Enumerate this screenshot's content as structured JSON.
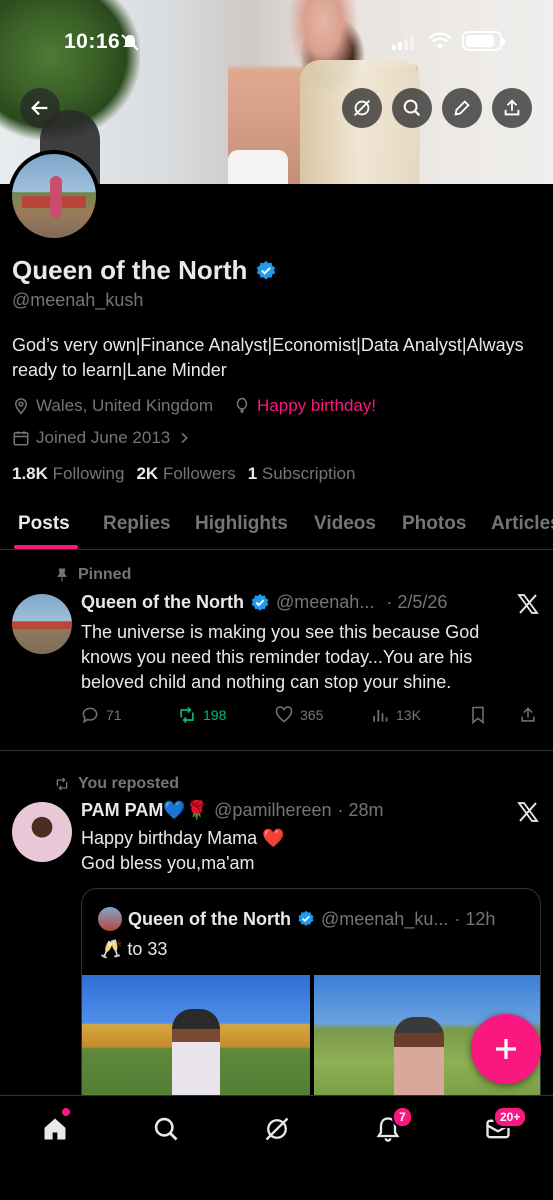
{
  "status_bar": {
    "time": "10:16"
  },
  "profile": {
    "display_name": "Queen of the North",
    "handle": "@meenah_kush",
    "bio": "God’s very own|Finance Analyst|Economist|Data Analyst|Always ready to learn|Lane Minder",
    "location": "Wales, United Kingdom",
    "birthday": "Happy birthday!",
    "joined": "Joined June 2013",
    "following_count": "1.8K",
    "following_label": "Following",
    "followers_count": "2K",
    "followers_label": "Followers",
    "subscriptions_count": "1",
    "subscriptions_label": "Subscription"
  },
  "tabs": [
    {
      "label": "Posts",
      "active": true
    },
    {
      "label": "Replies"
    },
    {
      "label": "Highlights"
    },
    {
      "label": "Videos"
    },
    {
      "label": "Photos"
    },
    {
      "label": "Articles"
    }
  ],
  "posts": [
    {
      "context": "Pinned",
      "name": "Queen of the North",
      "handle": "@meenah...",
      "time": "· 2/5/26",
      "text": "The universe is making you see this because God knows you need this reminder today...You are his beloved child and nothing can stop your shine.",
      "replies": "71",
      "reposts": "198",
      "likes": "365",
      "views": "13K"
    },
    {
      "context": "You reposted",
      "name": "PAM PAM💙🌹",
      "handle": "@pamilhereen",
      "time": "· 28m",
      "text_line1": "Happy birthday Mama ❤️",
      "text_line2": "God bless you,ma'am",
      "quote": {
        "name": "Queen of the North",
        "handle": "@meenah_ku...",
        "time": "· 12h",
        "text": "🥂 to  33"
      }
    }
  ],
  "bottom_nav": {
    "notifications_badge": "7",
    "messages_badge": "20+"
  },
  "colors": {
    "accent": "#f91880",
    "verified": "#1d9bf0",
    "retweet": "#00ba7c",
    "muted": "#71767b"
  }
}
